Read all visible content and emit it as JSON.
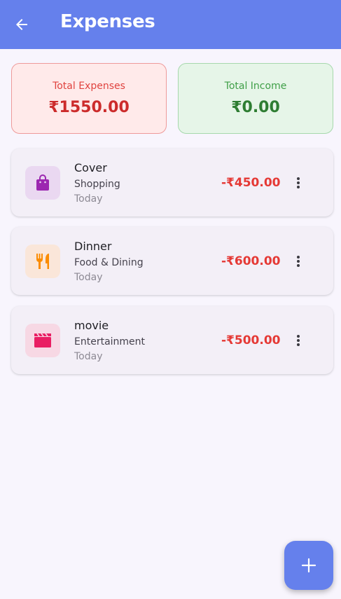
{
  "header": {
    "title": "Expenses",
    "back_icon": "arrow-left-icon",
    "color": "#6580ec"
  },
  "summary": {
    "expenses_label": "Total Expenses",
    "expenses_amount": "₹1550.00",
    "income_label": "Total Income",
    "income_amount": "₹0.00"
  },
  "transactions": [
    {
      "name": "Cover",
      "category": "Shopping",
      "date": "Today",
      "amount": "-₹450.00",
      "icon": "shopping-bag-icon",
      "icon_color": "#9c27b0",
      "icon_bg": "#ead8f1"
    },
    {
      "name": "Dinner",
      "category": "Food & Dining",
      "date": "Today",
      "amount": "-₹600.00",
      "icon": "fork-knife-icon",
      "icon_color": "#fb8c00",
      "icon_bg": "#fae6d9"
    },
    {
      "name": "movie",
      "category": "Entertainment",
      "date": "Today",
      "amount": "-₹500.00",
      "icon": "clapperboard-icon",
      "icon_color": "#e91e63",
      "icon_bg": "#f7d8e4"
    }
  ],
  "fab": {
    "icon": "plus-icon"
  }
}
